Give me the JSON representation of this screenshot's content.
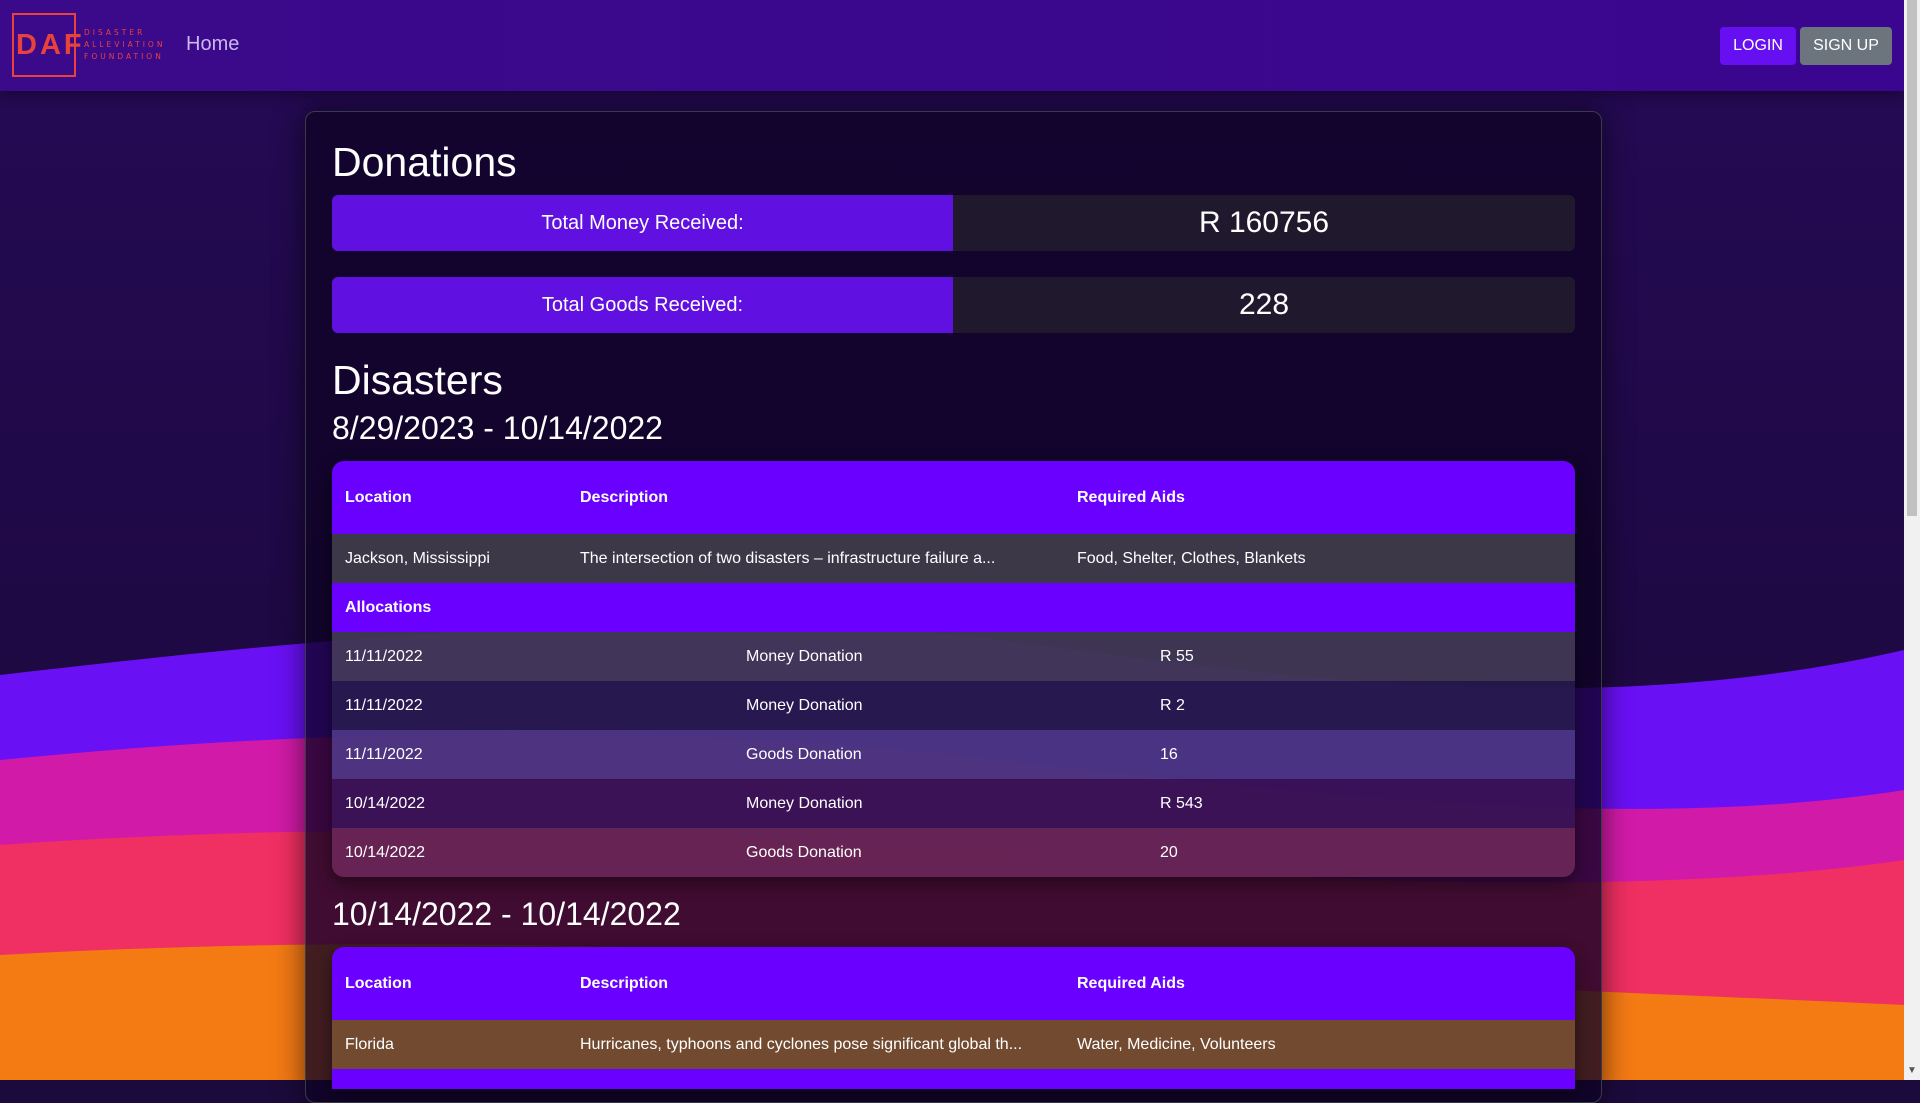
{
  "brand": {
    "abbr": "DAF",
    "line1": "DISASTER",
    "line2": "ALLEVIATION",
    "line3": "FOUNDATION",
    "color": "#e8423c"
  },
  "nav": {
    "home": "Home",
    "login": "LOGIN",
    "signup": "SIGN UP"
  },
  "donations": {
    "heading": "Donations",
    "money_label": "Total Money Received:",
    "money_value": "R 160756",
    "goods_label": "Total Goods Received:",
    "goods_value": "228"
  },
  "disasters": {
    "heading": "Disasters",
    "columns": [
      "Location",
      "Description",
      "Required Aids"
    ],
    "allocations_label": "Allocations",
    "groups": [
      {
        "range": "8/29/2023 - 10/14/2022",
        "location": "Jackson, Mississippi",
        "description": "The intersection of two disasters – infrastructure failure a...",
        "aids": "Food, Shelter, Clothes, Blankets",
        "allocations": [
          {
            "date": "11/11/2022",
            "type": "Money Donation",
            "amount": "R 55"
          },
          {
            "date": "11/11/2022",
            "type": "Money Donation",
            "amount": "R 2"
          },
          {
            "date": "11/11/2022",
            "type": "Goods Donation",
            "amount": "16"
          },
          {
            "date": "10/14/2022",
            "type": "Money Donation",
            "amount": "R 543"
          },
          {
            "date": "10/14/2022",
            "type": "Goods Donation",
            "amount": "20"
          }
        ]
      },
      {
        "range": "10/14/2022 - 10/14/2022",
        "location": "Florida",
        "description": "Hurricanes, typhoons and cyclones pose significant global th...",
        "aids": "Water, Medicine, Volunteers"
      }
    ]
  },
  "colors": {
    "accent": "#6a00ff",
    "navbar": "#3b068f",
    "login_button": "#6610f2",
    "signup_button": "#6c757d"
  }
}
